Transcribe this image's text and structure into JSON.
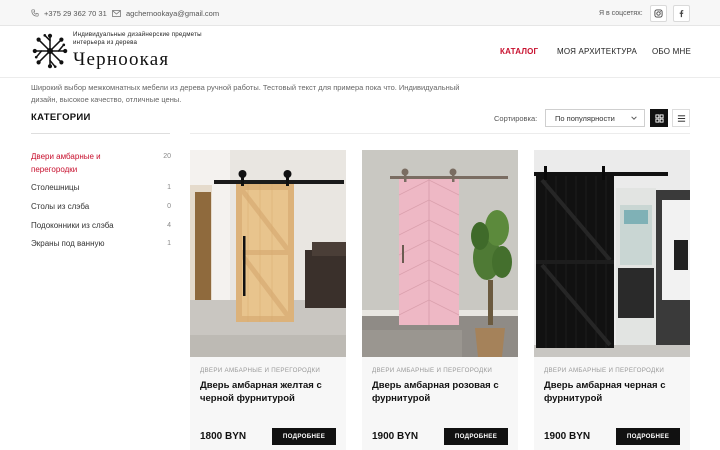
{
  "topbar": {
    "phone": "+375 29 362 70 31",
    "email": "agchernookaya@gmail.com",
    "social_label": "Я в соцсетях:",
    "icons": [
      "phone-icon",
      "mail-icon",
      "instagram-icon",
      "facebook-icon"
    ]
  },
  "header": {
    "logo_subtitle": "Индивидуальные дизайнерские предметы интерьера из дерева",
    "logo_title": "Черноокая",
    "nav": [
      {
        "label": "КАТАЛОГ",
        "active": true
      },
      {
        "label": "МОЯ АРХИТЕКТУРА",
        "active": false
      },
      {
        "label": "ОБО МНЕ",
        "active": false
      }
    ]
  },
  "intro": "Широкий выбор межкомнатных мебели из дерева ручной работы. Тестовый текст для примера пока что. Индивидуальный дизайн, высокое качество, отличные цены.",
  "sidebar": {
    "title": "КАТЕГОРИИ",
    "items": [
      {
        "label": "Двери амбарные и перегородки",
        "count": "20",
        "active": true
      },
      {
        "label": "Столешницы",
        "count": "1",
        "active": false
      },
      {
        "label": "Столы из слэба",
        "count": "0",
        "active": false
      },
      {
        "label": "Подоконники из слэба",
        "count": "4",
        "active": false
      },
      {
        "label": "Экраны под ванную",
        "count": "1",
        "active": false
      }
    ]
  },
  "sort": {
    "label": "Сортировка:",
    "selected": "По популярности",
    "views": [
      "grid-view-icon",
      "list-view-icon"
    ]
  },
  "products": [
    {
      "category": "ДВЕРИ АМБАРНЫЕ И ПЕРЕГОРОДКИ",
      "name": "Дверь амбарная желтая с черной фурнитурой",
      "price": "1800 BYN",
      "button": "ПОДРОБНЕЕ"
    },
    {
      "category": "ДВЕРИ АМБАРНЫЕ И ПЕРЕГОРОДКИ",
      "name": "Дверь амбарная розовая с фурнитурой",
      "price": "1900 BYN",
      "button": "ПОДРОБНЕЕ"
    },
    {
      "category": "ДВЕРИ АМБАРНЫЕ И ПЕРЕГОРОДКИ",
      "name": "Дверь амбарная черная с фурнитурой",
      "price": "1900 BYN",
      "button": "ПОДРОБНЕЕ"
    }
  ],
  "colors": {
    "accent": "#c8102e",
    "dark": "#111111",
    "card_bg": "#f7f7f7"
  }
}
